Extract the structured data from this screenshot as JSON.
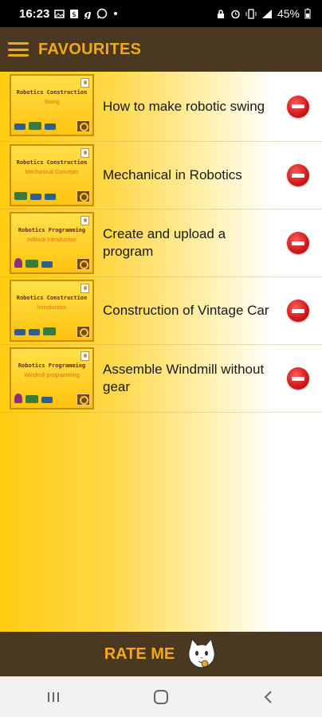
{
  "status_bar": {
    "time": "16:23",
    "notif_icons": [
      "photo-icon",
      "dollar-icon",
      "g-icon",
      "whatsapp-icon"
    ],
    "right_icons": [
      "lock-icon",
      "alarm-icon",
      "vibrate-icon",
      "signal-icon"
    ],
    "battery": "45%"
  },
  "app_bar": {
    "title": "FAVOURITES"
  },
  "favourites": [
    {
      "title": "How to make robotic swing",
      "thumb_header": "Robotics Construction",
      "thumb_subtitle": "Swing"
    },
    {
      "title": "Mechanical in Robotics",
      "thumb_header": "Robotics Construction",
      "thumb_subtitle": "Mechanical Concepts"
    },
    {
      "title": "Create and upload a program",
      "thumb_header": "Robotics Programming",
      "thumb_subtitle": "mBlock Introduction"
    },
    {
      "title": "Construction of Vintage Car",
      "thumb_header": "Robotics Construction",
      "thumb_subtitle": "Introduction"
    },
    {
      "title": "Assemble Windmill without gear",
      "thumb_header": "Robotics Programming",
      "thumb_subtitle": "Windmill programming"
    }
  ],
  "bottom_bar": {
    "rate_label": "RATE ME"
  },
  "colors": {
    "bar_bg": "#4a3820",
    "accent": "#f2a81c",
    "remove": "#d01818"
  }
}
